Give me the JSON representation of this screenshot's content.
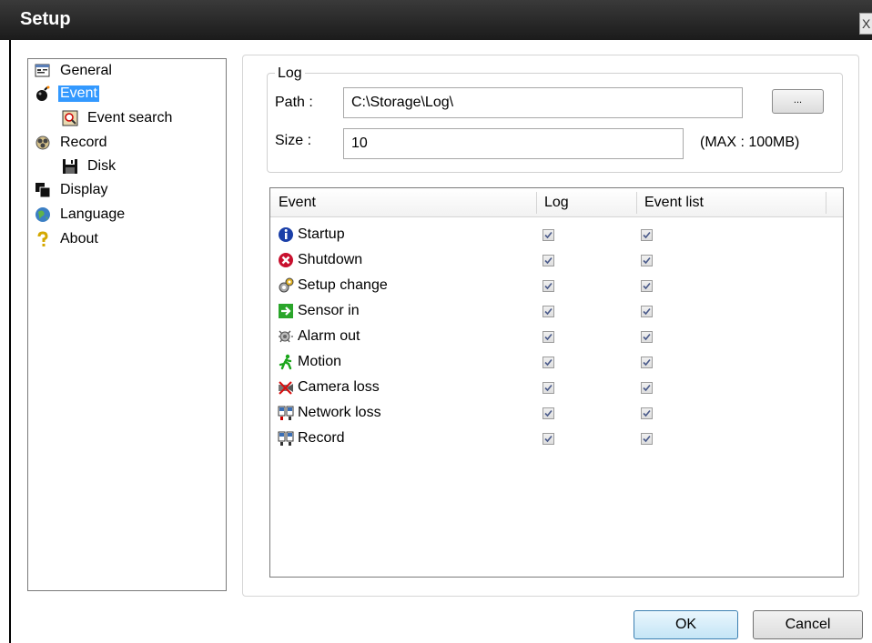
{
  "window": {
    "title": "Setup",
    "close_glyph": "X"
  },
  "tree": [
    {
      "label": "General",
      "icon": "general-icon"
    },
    {
      "label": "Event",
      "icon": "bomb-icon",
      "selected": true
    },
    {
      "label": "Event search",
      "icon": "event-search-icon"
    },
    {
      "label": "Record",
      "icon": "record-icon"
    },
    {
      "label": "Disk",
      "icon": "disk-icon"
    },
    {
      "label": "Display",
      "icon": "display-icon"
    },
    {
      "label": "Language",
      "icon": "globe-icon"
    },
    {
      "label": "About",
      "icon": "question-icon"
    }
  ],
  "log": {
    "legend": "Log",
    "path_label": "Path :",
    "path_value": "C:\\Storage\\Log\\",
    "browse_label": "...",
    "size_label": "Size :",
    "size_value": "10",
    "max_label": "(MAX : 100MB)"
  },
  "table": {
    "headers": [
      "Event",
      "Log",
      "Event list"
    ],
    "rows": [
      {
        "label": "Startup",
        "icon": "info-icon",
        "log": true,
        "event_list": true
      },
      {
        "label": "Shutdown",
        "icon": "shutdown-icon",
        "log": true,
        "event_list": true
      },
      {
        "label": "Setup change",
        "icon": "setup-change-icon",
        "log": true,
        "event_list": true
      },
      {
        "label": "Sensor in",
        "icon": "sensor-in-icon",
        "log": true,
        "event_list": true
      },
      {
        "label": "Alarm out",
        "icon": "alarm-out-icon",
        "log": true,
        "event_list": true
      },
      {
        "label": "Motion",
        "icon": "motion-icon",
        "log": true,
        "event_list": true
      },
      {
        "label": "Camera loss",
        "icon": "camera-loss-icon",
        "log": true,
        "event_list": true
      },
      {
        "label": "Network loss",
        "icon": "network-loss-icon",
        "log": true,
        "event_list": true
      },
      {
        "label": "Record",
        "icon": "record-event-icon",
        "log": true,
        "event_list": true
      }
    ]
  },
  "buttons": {
    "ok": "OK",
    "cancel": "Cancel"
  },
  "colors": {
    "titlebar": "#1b1b1b",
    "selection": "#3399ff",
    "ok_button": "#c4e5f6"
  }
}
